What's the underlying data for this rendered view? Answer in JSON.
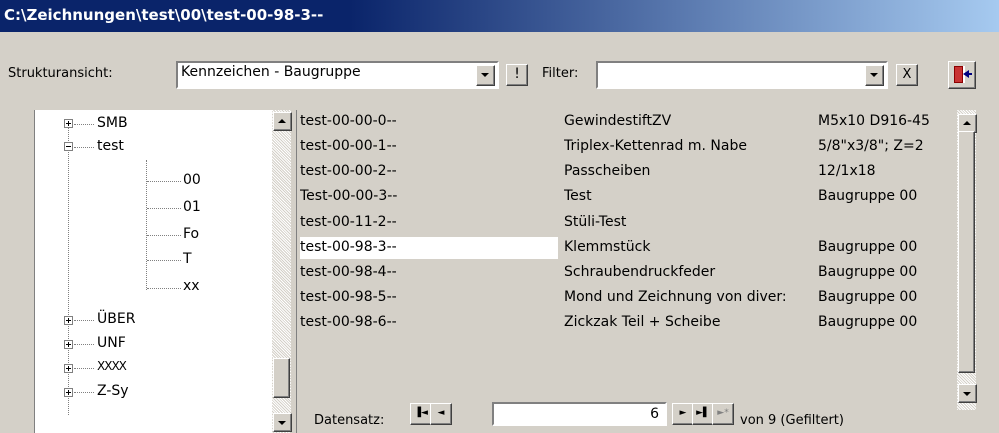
{
  "window": {
    "title": "C:\\Zeichnungen\\test\\00\\test-00-98-3--"
  },
  "toolbar": {
    "structure_label": "Strukturansicht:",
    "structure_value": "Kennzeichen - Baugruppe",
    "bang_label": "!",
    "filter_label": "Filter:",
    "filter_value": "",
    "clear_label": "X",
    "exit_icon": "exit-door-icon"
  },
  "tree": {
    "items": [
      {
        "label": "SMB",
        "expander": "+"
      },
      {
        "label": "test",
        "expander": "-"
      },
      {
        "label": "00"
      },
      {
        "label": "01"
      },
      {
        "label": "Fo"
      },
      {
        "label": "T"
      },
      {
        "label": "xx"
      },
      {
        "label": "ÜBER",
        "expander": "+"
      },
      {
        "label": "UNF",
        "expander": "+"
      },
      {
        "label": "XXXX",
        "expander": "+"
      },
      {
        "label": "Z-Sy",
        "expander": "+"
      }
    ]
  },
  "records": [
    {
      "id": "test-00-00-0--",
      "name": "GewindestiftZV",
      "info": "M5x10 D916-45"
    },
    {
      "id": "test-00-00-1--",
      "name": "Triplex-Kettenrad m. Nabe",
      "info": "5/8\"x3/8\"; Z=2"
    },
    {
      "id": "test-00-00-2--",
      "name": "Passcheiben",
      "info": "12/1x18"
    },
    {
      "id": "Test-00-00-3--",
      "name": "Test",
      "info": "Baugruppe 00"
    },
    {
      "id": "test-00-11-2--",
      "name": "Stüli-Test",
      "info": ""
    },
    {
      "id": "test-00-98-3--",
      "name": "Klemmstück",
      "info": "Baugruppe 00"
    },
    {
      "id": "test-00-98-4--",
      "name": "Schraubendruckfeder",
      "info": "Baugruppe 00"
    },
    {
      "id": "test-00-98-5--",
      "name": "Mond und Zeichnung von diver:",
      "info": "Baugruppe 00"
    },
    {
      "id": "test-00-98-6--",
      "name": "Zickzak Teil + Scheibe",
      "info": "Baugruppe 00"
    }
  ],
  "nav": {
    "label": "Datensatz:",
    "current": "6",
    "of_text": "von  9 (Gefiltert)",
    "first_glyph": "▐◄",
    "prev_glyph": "◄",
    "next_glyph": "►",
    "last_glyph": "►▌",
    "new_glyph": "►*"
  },
  "colors": {
    "title_bar": "#0a246a",
    "face": "#d4d0c8"
  }
}
